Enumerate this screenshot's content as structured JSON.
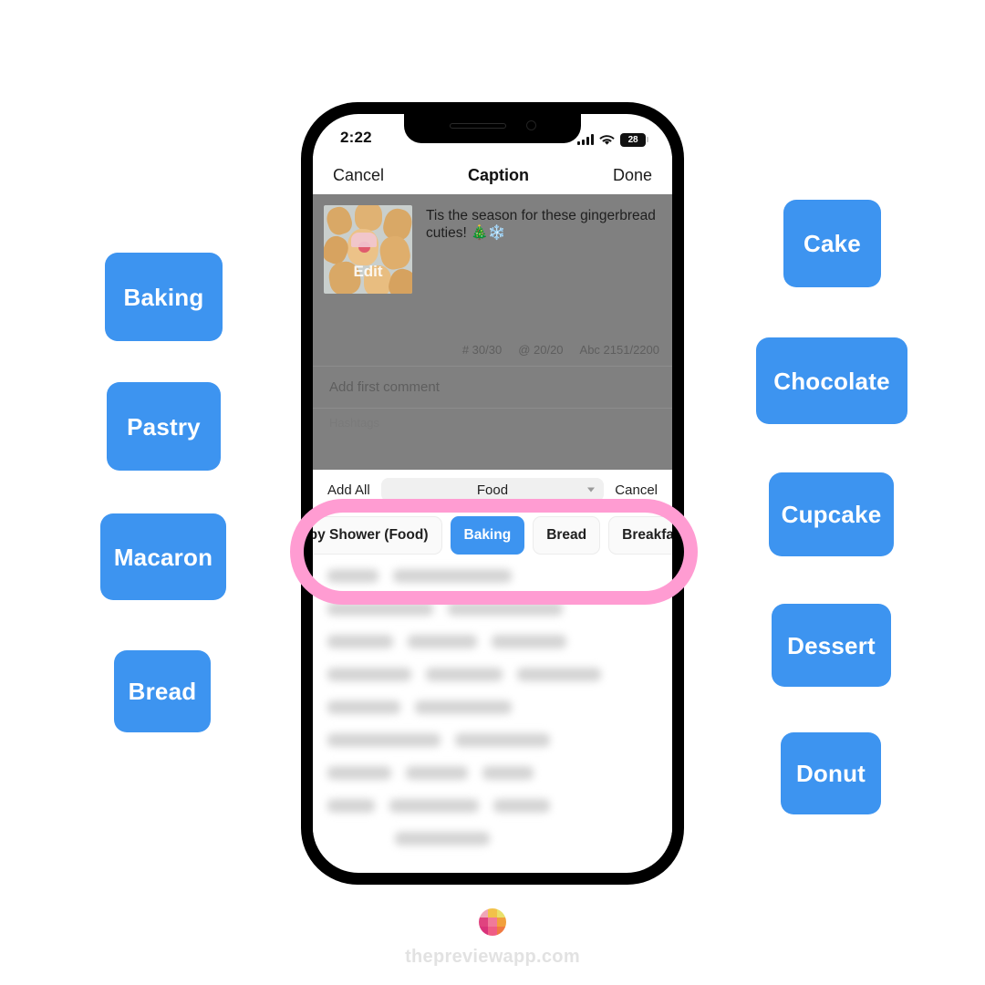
{
  "side_tags": {
    "left": [
      {
        "id": "tag-baking",
        "label": "Baking"
      },
      {
        "id": "tag-pastry",
        "label": "Pastry"
      },
      {
        "id": "tag-macaron",
        "label": "Macaron"
      },
      {
        "id": "tag-bread",
        "label": "Bread"
      }
    ],
    "right": [
      {
        "id": "tag-cake",
        "label": "Cake"
      },
      {
        "id": "tag-chocolate",
        "label": "Chocolate"
      },
      {
        "id": "tag-cupcake",
        "label": "Cupcake"
      },
      {
        "id": "tag-dessert",
        "label": "Dessert"
      },
      {
        "id": "tag-donut",
        "label": "Donut"
      }
    ]
  },
  "phone": {
    "status_bar": {
      "time": "2:22",
      "signal_icon": "cellular-signal-icon",
      "wifi_icon": "wifi-icon",
      "battery_level": "28"
    },
    "nav": {
      "cancel": "Cancel",
      "title": "Caption",
      "done": "Done"
    },
    "caption": {
      "thumb_edit_label": "Edit",
      "text": "Tis the season for these gingerbread cuties! 🎄❄️",
      "counter_hashtags": "# 30/30",
      "counter_mentions": "@ 20/20",
      "counter_characters": "Abc 2151/2200",
      "first_comment_placeholder": "Add first comment",
      "ghost_section_label": "Hashtags"
    },
    "hashtag_sheet": {
      "add_all_label": "Add All",
      "group_selected": "Food",
      "cancel_label": "Cancel",
      "chips": [
        {
          "label": "aby Shower (Food)",
          "selected": false
        },
        {
          "label": "Baking",
          "selected": true
        },
        {
          "label": "Bread",
          "selected": false
        },
        {
          "label": "Breakfast",
          "selected": false
        }
      ]
    }
  },
  "footer": {
    "logo_icon": "preview-app-logo-icon",
    "url": "thepreviewapp.com"
  },
  "colors": {
    "accent_blue": "#3d94f0",
    "highlight_pink": "#ff9cd2",
    "dim_overlay": "#808080"
  }
}
